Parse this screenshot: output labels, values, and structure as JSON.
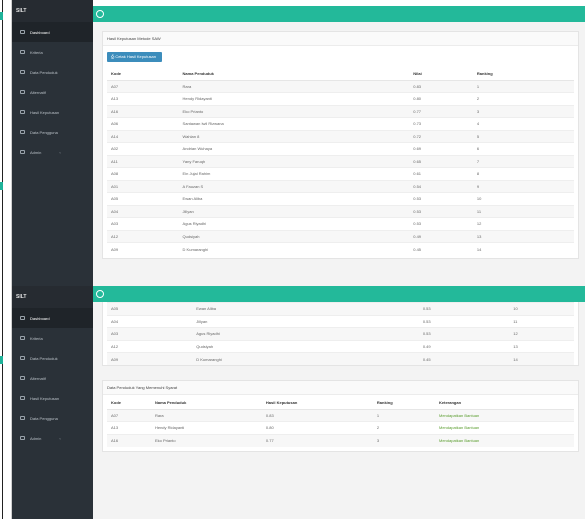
{
  "app": {
    "brand": "SILT"
  },
  "sidebar": {
    "items": [
      {
        "label": "Dashboard"
      },
      {
        "label": "Kriteria"
      },
      {
        "label": "Data Penduduk"
      },
      {
        "label": "Alternatif"
      },
      {
        "label": "Hasil Keputusan"
      },
      {
        "label": "Data Pengguna"
      },
      {
        "label": "Admin"
      }
    ]
  },
  "ranking_panel": {
    "title": "Hasil Keputusan Metode SAW",
    "print_label": "Cetak Hasil Keputusan",
    "columns": [
      "Kode",
      "Nama Penduduk",
      "Nilai",
      "Ranking"
    ],
    "rows": [
      [
        "A07",
        "Rara",
        "0.83",
        "1"
      ],
      [
        "A13",
        "Hendy Ridayanti",
        "0.80",
        "2"
      ],
      [
        "A16",
        "Eko Prianto",
        "0.77",
        "3"
      ],
      [
        "A06",
        "Santawan Iwil Rizwana",
        "0.73",
        "4"
      ],
      [
        "A14",
        "Wahlan 8",
        "0.72",
        "5"
      ],
      [
        "A02",
        "Andrian Wuhaya",
        "0.69",
        "6"
      ],
      [
        "A11",
        "Yany Faruqh",
        "0.65",
        "7"
      ],
      [
        "A08",
        "Ein Jujal Rahim",
        "0.61",
        "8"
      ],
      [
        "A01",
        "A Fauzan S",
        "0.54",
        "9"
      ],
      [
        "A05",
        "Ewan Aliba",
        "0.53",
        "10"
      ],
      [
        "A04",
        "Jillyan",
        "0.53",
        "11"
      ],
      [
        "A03",
        "Agus Riyadhi",
        "0.53",
        "12"
      ],
      [
        "A12",
        "Qudsiyah",
        "0.49",
        "13"
      ],
      [
        "A09",
        "D Kumaranghi",
        "0.45",
        "14"
      ]
    ]
  },
  "ranking_tail": {
    "rows": [
      [
        "A05",
        "Ewan Aliba",
        "0.53",
        "10"
      ],
      [
        "A04",
        "Jillyan",
        "0.53",
        "11"
      ],
      [
        "A03",
        "Agus Riyadhi",
        "0.53",
        "12"
      ],
      [
        "A12",
        "Qudsiyah",
        "0.49",
        "13"
      ],
      [
        "A09",
        "D Kumaranghi",
        "0.45",
        "14"
      ]
    ]
  },
  "eligible_panel": {
    "title": "Data Penduduk Yang Memenuhi Syarat",
    "columns": [
      "Kode",
      "Nama Penduduk",
      "Hasil Keputusan",
      "Ranking",
      "Keterangan"
    ],
    "rows": [
      [
        "A07",
        "Rara",
        "0.83",
        "1",
        "Mendapatkan Bantuan"
      ],
      [
        "A13",
        "Hendy Ridayanti",
        "0.80",
        "2",
        "Mendapatkan Bantuan"
      ],
      [
        "A16",
        "Eko Prianto",
        "0.77",
        "3",
        "Mendapatkan Bantuan"
      ]
    ]
  },
  "colors": {
    "topbar": "#23b99a",
    "sidebar": "#2a3138",
    "print_button": "#3c8dbc",
    "keterangan_text": "#5a9d2e"
  },
  "icons": [
    "hamburger-menu-icon",
    "dashboard-icon",
    "kriteria-icon",
    "people-icon",
    "alternatif-icon",
    "result-icon",
    "users-icon",
    "admin-icon",
    "print-icon"
  ]
}
